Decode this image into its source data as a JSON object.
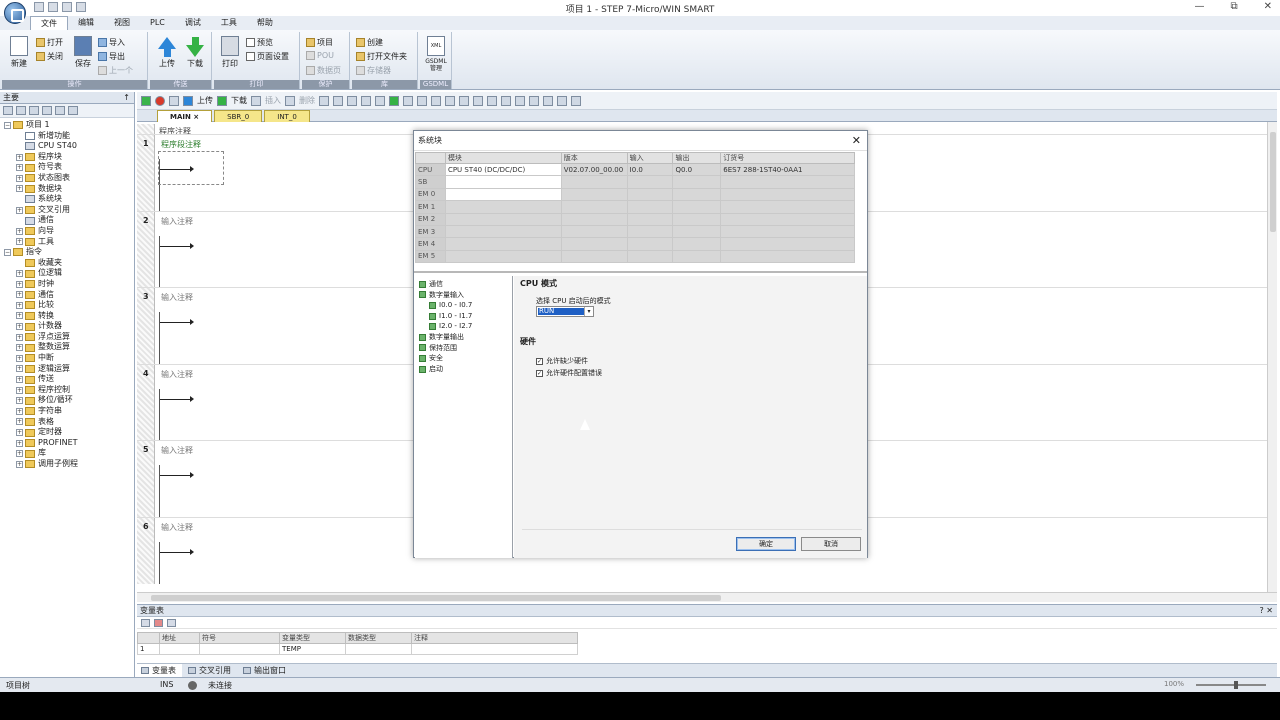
{
  "window": {
    "title": "项目 1 - STEP 7-Micro/WIN SMART",
    "controls": [
      "—",
      "⧉",
      "✕"
    ]
  },
  "ribbon_tabs": [
    "文件",
    "编辑",
    "视图",
    "PLC",
    "调试",
    "工具",
    "帮助"
  ],
  "ribbon": {
    "groups": [
      "操作",
      "传送",
      "打印",
      "保护",
      "库",
      "GSDML"
    ],
    "new": "新建",
    "open": "打开",
    "close": "关闭",
    "save": "保存",
    "import": "导入",
    "export": "导出",
    "prev": "上一个",
    "upload": "上传",
    "download": "下载",
    "print": "打印",
    "preview": "预览",
    "page_setup": "页面设置",
    "item": "项目",
    "pou": "POU",
    "data_page": "数据页",
    "create": "创建",
    "open_folder": "打开文件夹",
    "memory": "存储器",
    "gsdml_mgmt": "GSDML 管理"
  },
  "left_panel": {
    "title": "主要",
    "pin": "↑",
    "tree": [
      {
        "pm": "−",
        "indent": 0,
        "icon": "folder",
        "label": "项目 1"
      },
      {
        "pm": "",
        "indent": 1,
        "icon": "blank",
        "label": "新增功能"
      },
      {
        "pm": "",
        "indent": 1,
        "icon": "box",
        "label": "CPU ST40"
      },
      {
        "pm": "+",
        "indent": 1,
        "icon": "folder",
        "label": "程序块"
      },
      {
        "pm": "+",
        "indent": 1,
        "icon": "folder",
        "label": "符号表"
      },
      {
        "pm": "+",
        "indent": 1,
        "icon": "folder",
        "label": "状态图表"
      },
      {
        "pm": "+",
        "indent": 1,
        "icon": "folder",
        "label": "数据块"
      },
      {
        "pm": "",
        "indent": 1,
        "icon": "box",
        "label": "系统块"
      },
      {
        "pm": "+",
        "indent": 1,
        "icon": "folder",
        "label": "交叉引用"
      },
      {
        "pm": "",
        "indent": 1,
        "icon": "box",
        "label": "通信"
      },
      {
        "pm": "+",
        "indent": 1,
        "icon": "folder",
        "label": "向导"
      },
      {
        "pm": "+",
        "indent": 1,
        "icon": "folder",
        "label": "工具"
      },
      {
        "pm": "−",
        "indent": 0,
        "icon": "folder",
        "label": "指令"
      },
      {
        "pm": "",
        "indent": 1,
        "icon": "folder",
        "label": "收藏夹"
      },
      {
        "pm": "+",
        "indent": 1,
        "icon": "folder",
        "label": "位逻辑"
      },
      {
        "pm": "+",
        "indent": 1,
        "icon": "folder",
        "label": "时钟"
      },
      {
        "pm": "+",
        "indent": 1,
        "icon": "folder",
        "label": "通信"
      },
      {
        "pm": "+",
        "indent": 1,
        "icon": "folder",
        "label": "比较"
      },
      {
        "pm": "+",
        "indent": 1,
        "icon": "folder",
        "label": "转换"
      },
      {
        "pm": "+",
        "indent": 1,
        "icon": "folder",
        "label": "计数器"
      },
      {
        "pm": "+",
        "indent": 1,
        "icon": "folder",
        "label": "浮点运算"
      },
      {
        "pm": "+",
        "indent": 1,
        "icon": "folder",
        "label": "整数运算"
      },
      {
        "pm": "+",
        "indent": 1,
        "icon": "folder",
        "label": "中断"
      },
      {
        "pm": "+",
        "indent": 1,
        "icon": "folder",
        "label": "逻辑运算"
      },
      {
        "pm": "+",
        "indent": 1,
        "icon": "folder",
        "label": "传送"
      },
      {
        "pm": "+",
        "indent": 1,
        "icon": "folder",
        "label": "程序控制"
      },
      {
        "pm": "+",
        "indent": 1,
        "icon": "folder",
        "label": "移位/循环"
      },
      {
        "pm": "+",
        "indent": 1,
        "icon": "folder",
        "label": "字符串"
      },
      {
        "pm": "+",
        "indent": 1,
        "icon": "folder",
        "label": "表格"
      },
      {
        "pm": "+",
        "indent": 1,
        "icon": "folder",
        "label": "定时器"
      },
      {
        "pm": "+",
        "indent": 1,
        "icon": "folder",
        "label": "PROFINET"
      },
      {
        "pm": "+",
        "indent": 1,
        "icon": "folder",
        "label": "库"
      },
      {
        "pm": "+",
        "indent": 1,
        "icon": "folder",
        "label": "调用子例程"
      }
    ]
  },
  "editor": {
    "toolbar": {
      "upload": "上传",
      "download": "下载",
      "insert": "插入",
      "delete": "删除"
    },
    "tabs": [
      "MAIN",
      "SBR_0",
      "INT_0"
    ],
    "tab_close": "×",
    "program_comment": "程序注释",
    "networks": [
      {
        "num": "1",
        "comment": "程序段注释"
      },
      {
        "num": "2",
        "comment": "输入注释"
      },
      {
        "num": "3",
        "comment": "输入注释"
      },
      {
        "num": "4",
        "comment": "输入注释"
      },
      {
        "num": "5",
        "comment": "输入注释"
      },
      {
        "num": "6",
        "comment": "输入注释"
      }
    ]
  },
  "dialog": {
    "title": "系统块",
    "close": "✕",
    "columns": [
      "",
      "模块",
      "版本",
      "输入",
      "输出",
      "订货号"
    ],
    "rows": [
      {
        "slot": "CPU",
        "module": "CPU ST40 (DC/DC/DC)",
        "version": "V02.07.00_00.00",
        "input": "I0.0",
        "output": "Q0.0",
        "order": "6ES7 288-1ST40-0AA1"
      },
      {
        "slot": "SB",
        "module": "",
        "version": "",
        "input": "",
        "output": "",
        "order": ""
      },
      {
        "slot": "EM 0",
        "module": "",
        "version": "",
        "input": "",
        "output": "",
        "order": ""
      },
      {
        "slot": "EM 1",
        "module": "",
        "version": "",
        "input": "",
        "output": "",
        "order": ""
      },
      {
        "slot": "EM 2",
        "module": "",
        "version": "",
        "input": "",
        "output": "",
        "order": ""
      },
      {
        "slot": "EM 3",
        "module": "",
        "version": "",
        "input": "",
        "output": "",
        "order": ""
      },
      {
        "slot": "EM 4",
        "module": "",
        "version": "",
        "input": "",
        "output": "",
        "order": ""
      },
      {
        "slot": "EM 5",
        "module": "",
        "version": "",
        "input": "",
        "output": "",
        "order": ""
      }
    ],
    "tree": [
      {
        "indent": 0,
        "label": "通信"
      },
      {
        "indent": 0,
        "label": "数字量输入"
      },
      {
        "indent": 1,
        "label": "I0.0 - I0.7"
      },
      {
        "indent": 1,
        "label": "I1.0 - I1.7"
      },
      {
        "indent": 1,
        "label": "I2.0 - I2.7"
      },
      {
        "indent": 0,
        "label": "数字量输出"
      },
      {
        "indent": 0,
        "label": "保持范围"
      },
      {
        "indent": 0,
        "label": "安全"
      },
      {
        "indent": 0,
        "label": "启动"
      }
    ],
    "cpu_mode": {
      "heading": "CPU 模式",
      "label": "选择 CPU 启动后的模式",
      "value": "RUN",
      "dd": "▾"
    },
    "hardware": {
      "heading": "硬件",
      "options": [
        {
          "label": "允许缺少硬件",
          "checked": "✓"
        },
        {
          "label": "允许硬件配置错误",
          "checked": "✓"
        }
      ]
    },
    "ok": "确定",
    "cancel": "取消"
  },
  "bottom_panel": {
    "title": "变量表",
    "controls": "? ✕",
    "columns": [
      "",
      "地址",
      "符号",
      "变量类型",
      "数据类型",
      "注释"
    ],
    "rows": [
      [
        "1",
        "",
        "",
        "TEMP",
        "",
        ""
      ]
    ],
    "tabs": [
      "变量表",
      "交叉引用",
      "输出窗口"
    ]
  },
  "status_bar": {
    "left": "项目树",
    "ins": "INS",
    "connection": "未连接",
    "zoom": "100%"
  }
}
